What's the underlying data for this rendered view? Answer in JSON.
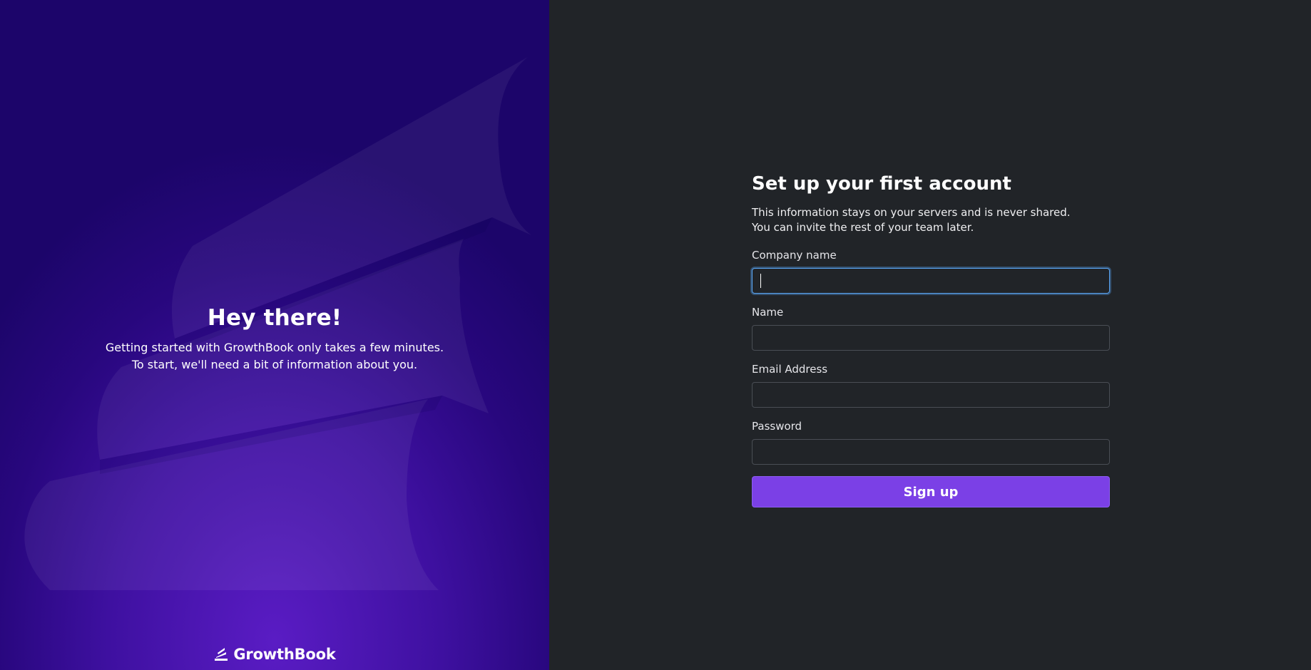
{
  "hero": {
    "title": "Hey there!",
    "subtitle_line1": "Getting started with GrowthBook only takes a few minutes.",
    "subtitle_line2": "To start, we'll need a bit of information about you.",
    "logo_text": "GrowthBook",
    "logo_icon": "growthbook-logo-icon"
  },
  "form": {
    "title": "Set up your first account",
    "desc_line1": "This information stays on your servers and is never shared.",
    "desc_line2": "You can invite the rest of your team later.",
    "fields": [
      {
        "label": "Company name",
        "value": "",
        "focused": true
      },
      {
        "label": "Name",
        "value": ""
      },
      {
        "label": "Email Address",
        "value": ""
      },
      {
        "label": "Password",
        "value": ""
      }
    ],
    "submit_label": "Sign up"
  },
  "colors": {
    "left_panel": "#3e10a0",
    "right_panel": "#212428",
    "primary_button": "#7b40e6",
    "focus_ring": "#5aa6f5"
  }
}
